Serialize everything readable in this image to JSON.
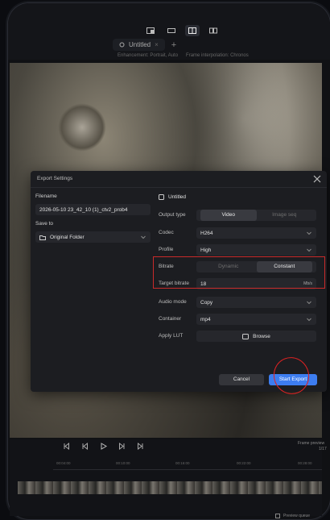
{
  "toolbar": {
    "view_buttons": [
      "single-view",
      "wide-view",
      "split-view",
      "dual-view"
    ]
  },
  "tabs": {
    "active_tab": "Untitled",
    "add_tab": "+"
  },
  "status": {
    "left": "Enhancement: Portrait, Auto",
    "right": "Frame interpolation: Chronos"
  },
  "dialog": {
    "title": "Export Settings",
    "filename_label": "Filename",
    "filename_value": "2026-05-10 23_42_10 (1)_ctv2_prob4",
    "save_to_label": "Save to",
    "save_to_value": "Original Folder",
    "project_name": "Untitled",
    "output_type_label": "Output type",
    "output_type_options": [
      "Video",
      "Image seq"
    ],
    "output_type_selected": "Video",
    "codec_label": "Codec",
    "codec_value": "H264",
    "profile_label": "Profile",
    "profile_value": "High",
    "bitrate_label": "Bitrate",
    "bitrate_options": [
      "Dynamic",
      "Constant"
    ],
    "bitrate_selected": "Constant",
    "target_bitrate_label": "Target bitrate",
    "target_bitrate_value": "18",
    "target_bitrate_unit": "Mb/s",
    "audio_mode_label": "Audio mode",
    "audio_mode_value": "Copy",
    "container_label": "Container",
    "container_value": "mp4",
    "apply_lut_label": "Apply LUT",
    "browse_label": "Browse",
    "cancel_label": "Cancel",
    "start_export_label": "Start Export"
  },
  "timeline": {
    "frame_preview_label": "Frame preview",
    "frame_preview_value": "1/17",
    "ruler_ticks": [
      "00:04:00",
      "00:10:00",
      "00:16:00",
      "00:22:00",
      "00:28:00"
    ],
    "preview_queue_label": "Preview queue"
  },
  "colors": {
    "accent": "#3d7df0",
    "annotation": "#c92a2a",
    "panel": "#1c1d21"
  }
}
